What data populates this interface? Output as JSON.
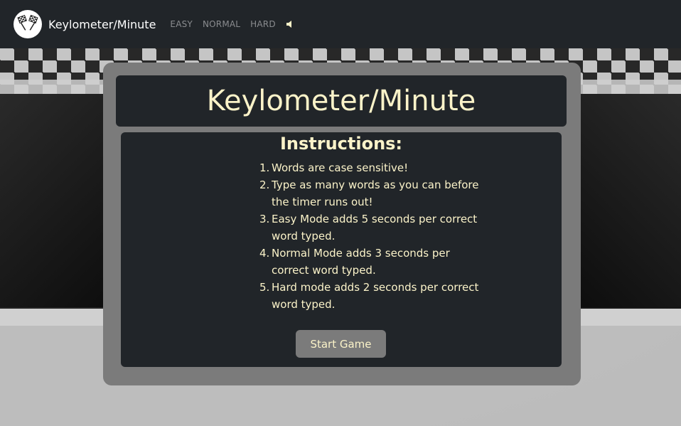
{
  "navbar": {
    "brand": "Keylometer/Minute",
    "links": [
      "EASY",
      "NORMAL",
      "HARD"
    ],
    "logo_icon": "checkered-flags-icon",
    "sound_icon": "speaker-icon"
  },
  "main": {
    "title": "Keylometer/Minute",
    "instructions_heading": "Instructions:",
    "items": [
      {
        "num": "1.",
        "text": "Words are case sensitive!"
      },
      {
        "num": "2.",
        "text": "Type as many words as you can before the timer runs out!"
      },
      {
        "num": "3.",
        "text": "Easy Mode adds 5 seconds per correct word typed."
      },
      {
        "num": "4.",
        "text": "Normal Mode adds 3 seconds per correct word typed."
      },
      {
        "num": "5.",
        "text": "Hard mode adds 2 seconds per correct word typed."
      }
    ],
    "start_button": "Start Game"
  },
  "colors": {
    "accent_text": "#fbf3c9",
    "panel": "#212529",
    "card": "#7b7b7b"
  }
}
